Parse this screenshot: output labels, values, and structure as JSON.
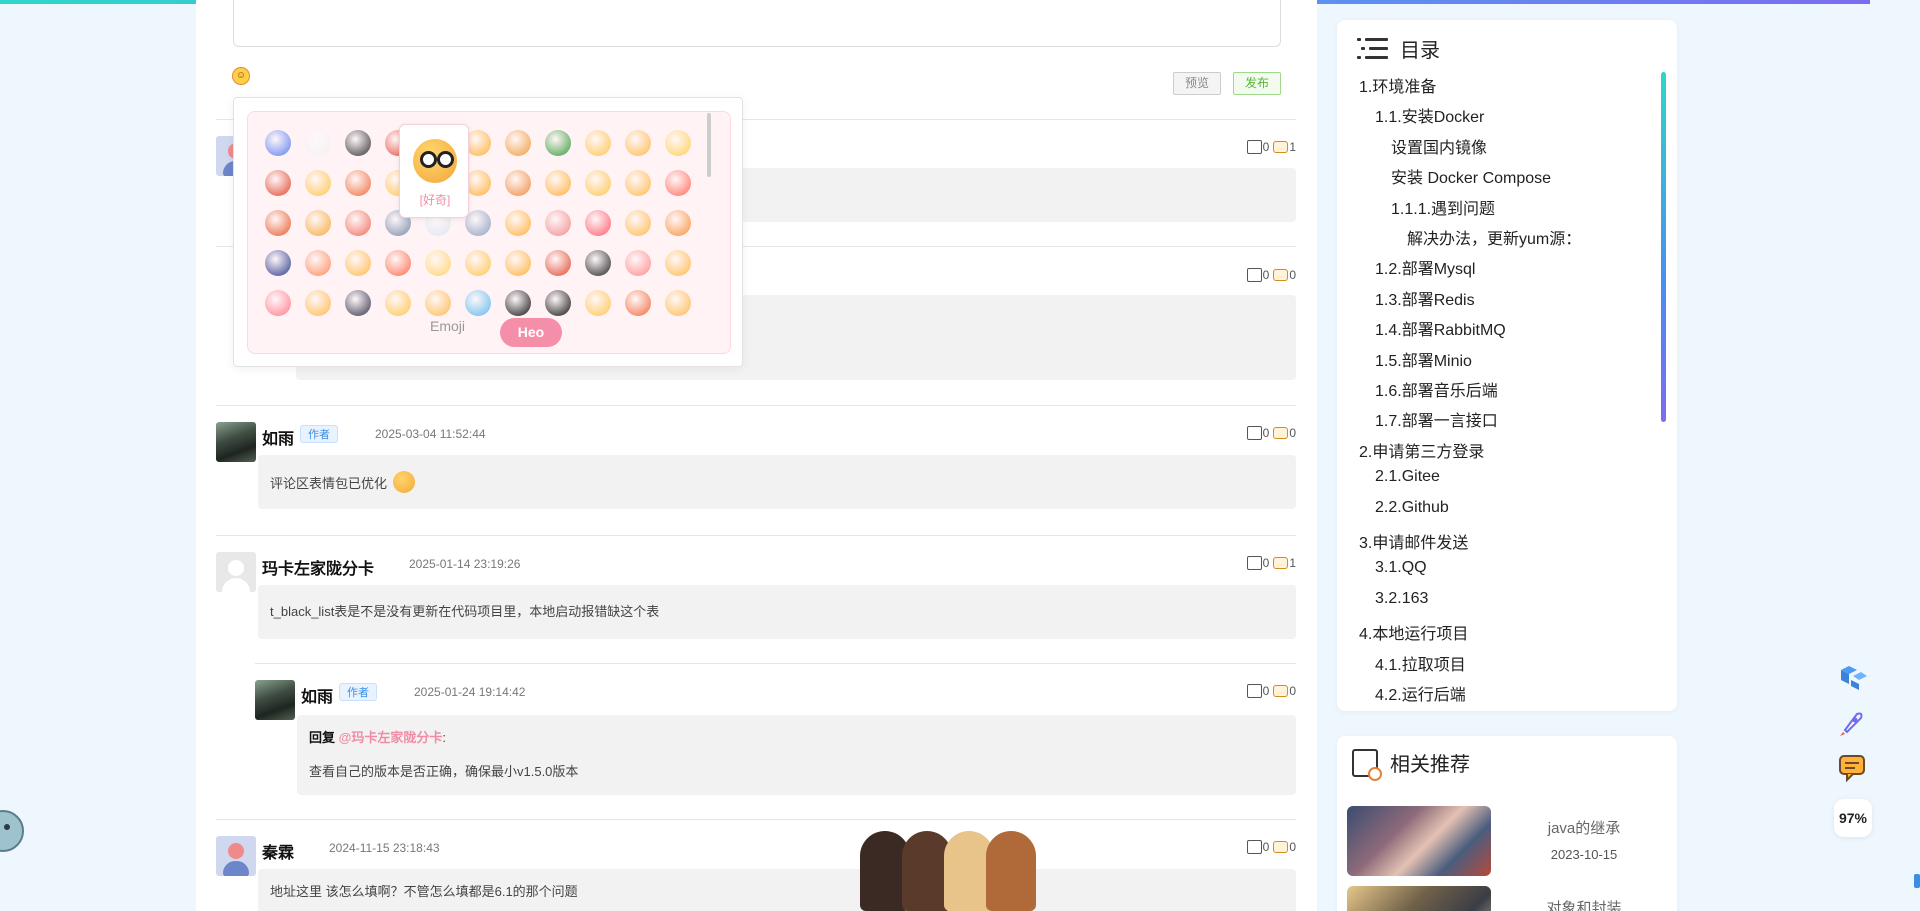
{
  "editor": {
    "emoji_toggle_icon": "smile-icon"
  },
  "buttons": {
    "preview": "预览",
    "publish": "发布"
  },
  "emoji_picker": {
    "tabs": [
      "Emoji",
      "Heo"
    ],
    "active_tab": "Heo",
    "hover_preview_label": "[好奇]",
    "emoji_colors": [
      "#5b7ff0",
      "#f2f2f2",
      "#333333",
      "#e74c3c",
      "#ffc44d",
      "#ffb13a",
      "#f0993a",
      "#3b9a3b",
      "#ffc44d",
      "#ffb84a",
      "#ffcf55",
      "#e0472c",
      "#ffc44d",
      "#f06b3a",
      "#ffc44d",
      "#ffb84a",
      "#ffb13a",
      "#f08a3a",
      "#ffb13a",
      "#ffc44d",
      "#ffb84a",
      "#ff6b5a",
      "#e85a2c",
      "#f7a83a",
      "#f06b5a",
      "#7a8aa8",
      "#dfe6f0",
      "#8da0bf",
      "#ffb13a",
      "#f08a8a",
      "#ff5a6a",
      "#ffb84a",
      "#f7903a",
      "#2d3a8a",
      "#ff8a5a",
      "#ffb84a",
      "#ff6b4a",
      "#ffd46a",
      "#ffc44d",
      "#ffb13a",
      "#e0472c",
      "#222222",
      "#ff8a8a",
      "#ffb84a",
      "#ff7a8a",
      "#ffb84a",
      "#33334a",
      "#ffc44d",
      "#ffb84a",
      "#5fb8f0",
      "#111111",
      "#111111",
      "#ffc44d",
      "#f26a3a",
      "#ffb84a"
    ]
  },
  "comments": [
    {
      "likes": "0",
      "replies": "1"
    },
    {
      "likes": "0",
      "replies": "0"
    },
    {
      "name": "如雨",
      "tag": "作者",
      "time": "2025-03-04 11:52:44",
      "likes": "0",
      "replies": "0",
      "body": "评论区表情包已优化"
    },
    {
      "name": "玛卡左家陇分卡",
      "time": "2025-01-14 23:19:26",
      "likes": "0",
      "replies": "1",
      "body": "t_black_list表是不是没有更新在代码项目里，本地启动报错缺这个表"
    },
    {
      "name": "如雨",
      "tag": "作者",
      "time": "2025-01-24 19:14:42",
      "likes": "0",
      "replies": "0",
      "reply_prefix": "回复",
      "reply_to": "@玛卡左家陇分卡",
      "reply_colon": ":",
      "body": "查看自己的版本是否正确，确保最小v1.5.0版本"
    },
    {
      "name": "秦霖",
      "time": "2024-11-15 23:18:43",
      "likes": "0",
      "replies": "0",
      "body": "地址这里 该怎么填啊？不管怎么填都是6.1的那个问题"
    }
  ],
  "toc": {
    "title": "目录",
    "items": [
      "1.环境准备",
      "1.1.安装Docker",
      "设置国内镜像",
      "安装 Docker Compose",
      "1.1.1.遇到问题",
      "解决办法，更新yum源：",
      "1.2.部署Mysql",
      "1.3.部署Redis",
      "1.4.部署RabbitMQ",
      "1.5.部署Minio",
      "1.6.部署音乐后端",
      "1.7.部署一言接口",
      "2.申请第三方登录",
      "2.1.Gitee",
      "2.2.Github",
      "3.申请邮件发送",
      "3.1.QQ",
      "3.2.163",
      "4.本地运行项目",
      "4.1.拉取项目",
      "4.2.运行后端"
    ]
  },
  "recommend": {
    "title": "相关推荐",
    "items": [
      {
        "title": "java的继承",
        "date": "2023-10-15"
      },
      {
        "title": "对象和封装"
      }
    ]
  },
  "float_tools": {
    "progress": "97%"
  },
  "colors": {
    "accent": "#f58ea9",
    "tag_blue": "#3a8ee6",
    "mention": "#f08da6",
    "publish_green": "#58b43a"
  }
}
